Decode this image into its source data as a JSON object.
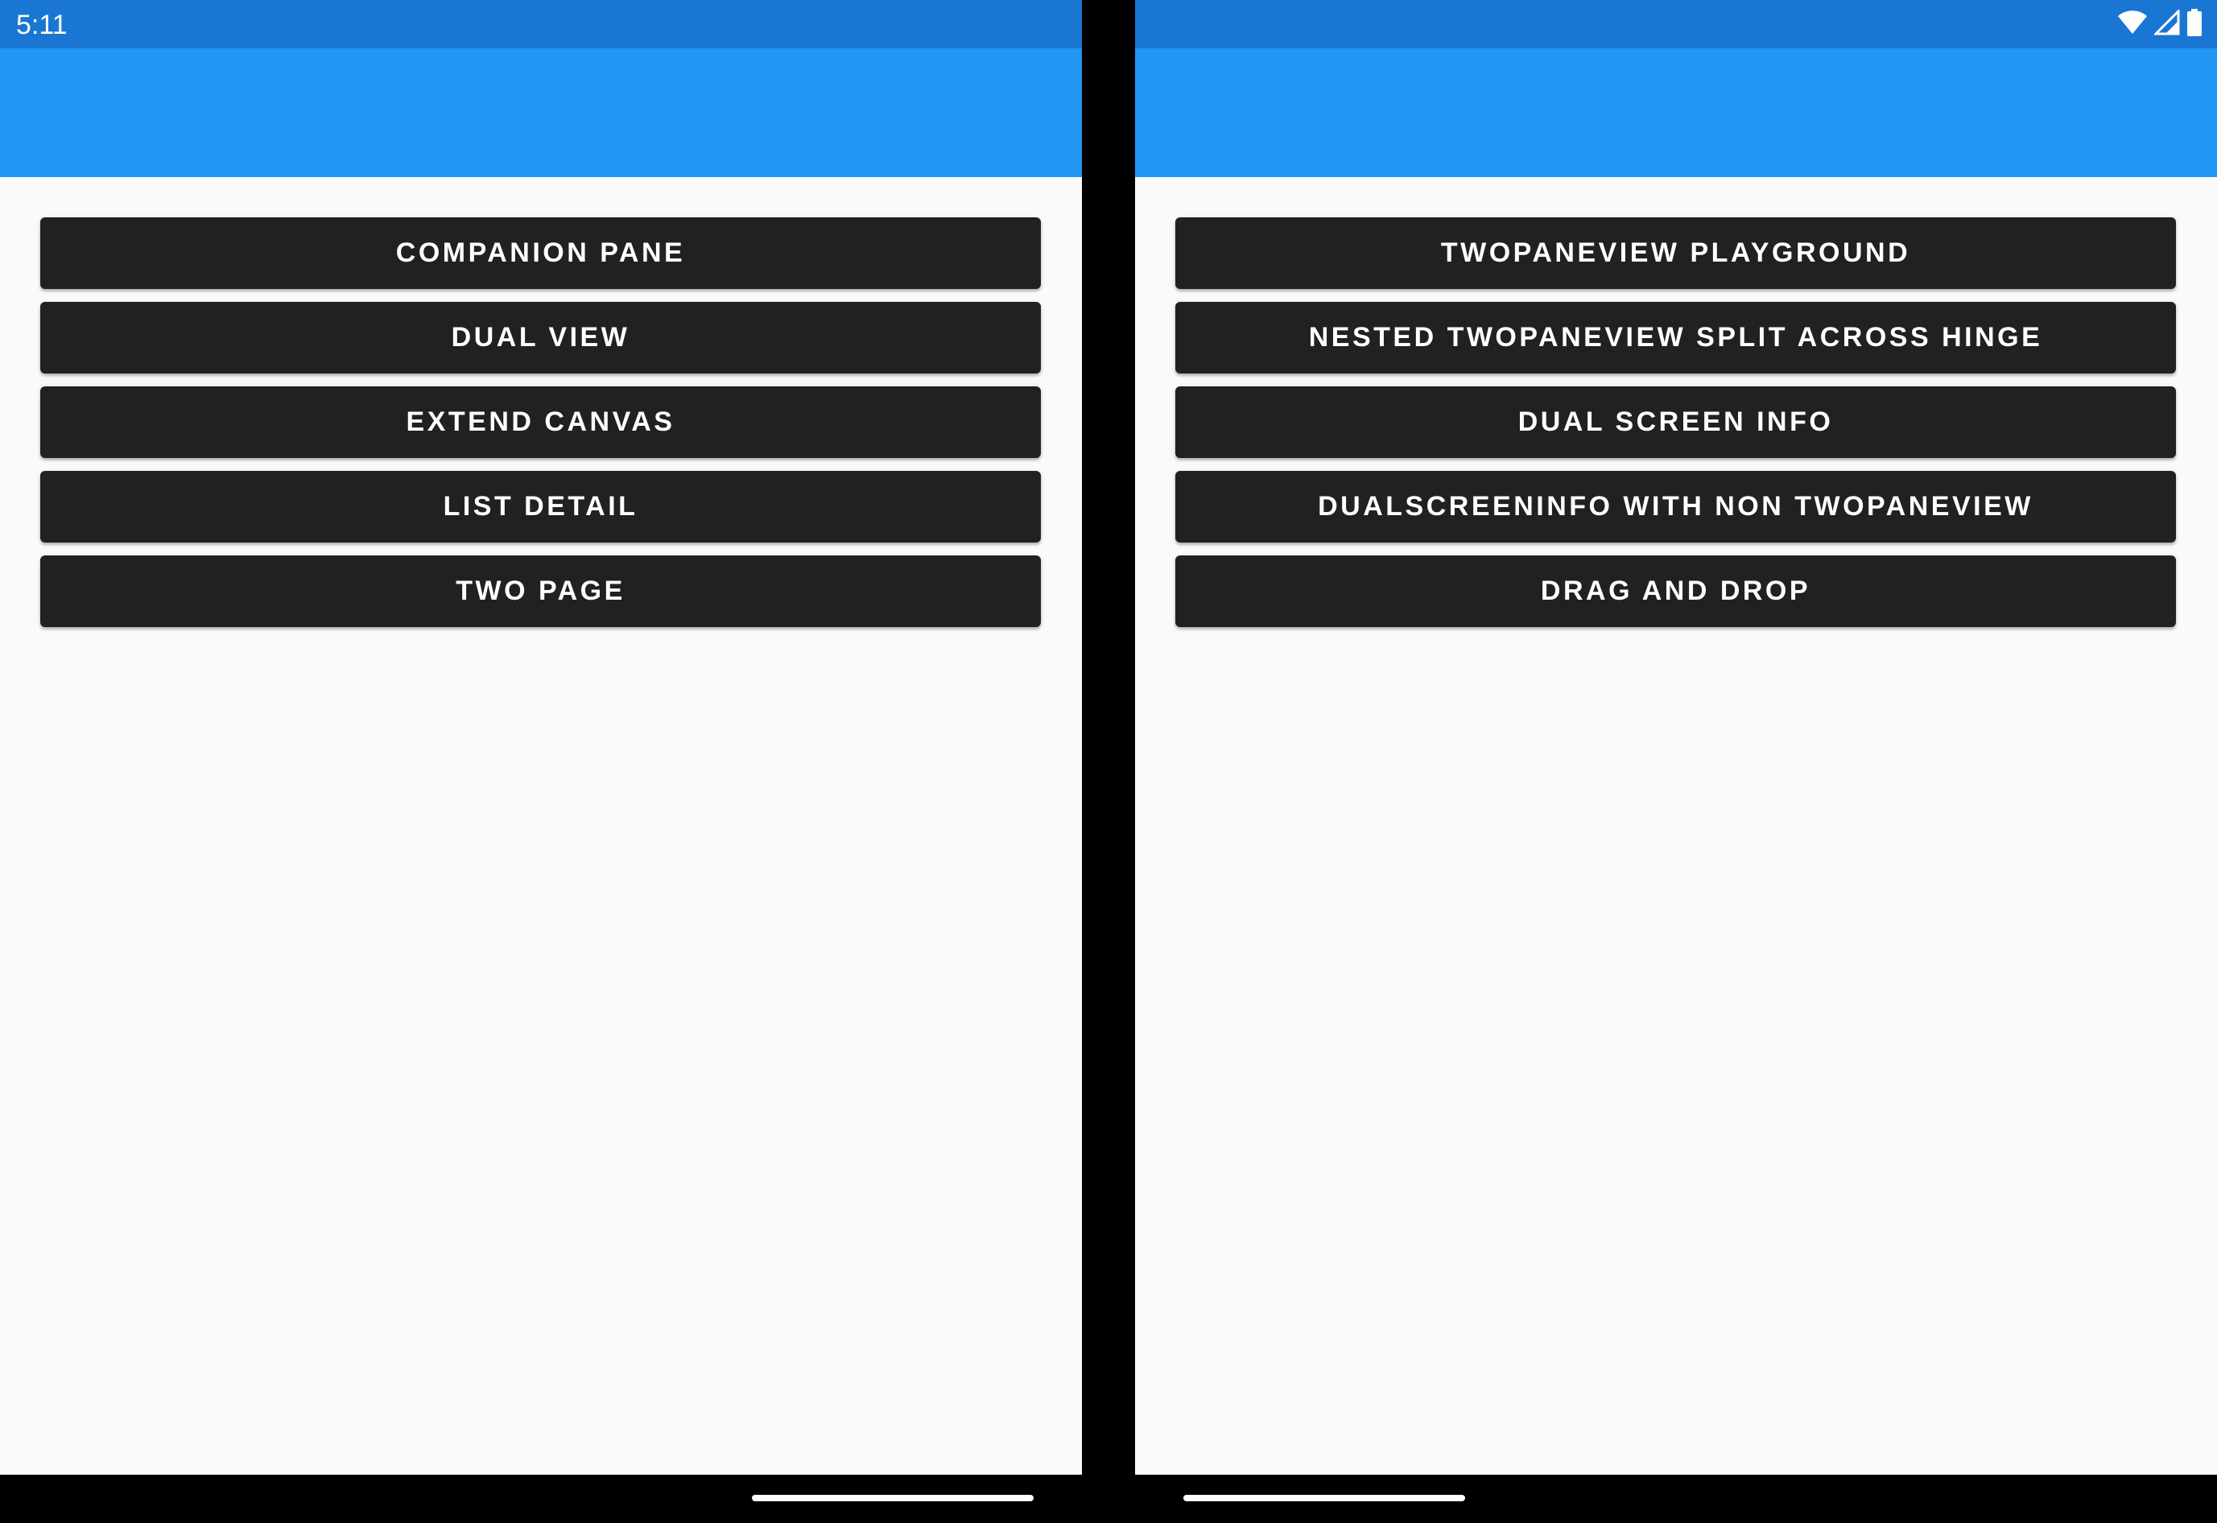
{
  "status_bar": {
    "time": "5:11",
    "icons": [
      "wifi-icon",
      "cell-signal-icon",
      "battery-icon"
    ]
  },
  "left_pane": {
    "buttons": [
      {
        "label": "COMPANION PANE"
      },
      {
        "label": "DUAL VIEW"
      },
      {
        "label": "EXTEND CANVAS"
      },
      {
        "label": "LIST DETAIL"
      },
      {
        "label": "TWO PAGE"
      }
    ]
  },
  "right_pane": {
    "buttons": [
      {
        "label": "TWOPANEVIEW PLAYGROUND"
      },
      {
        "label": "NESTED TWOPANEVIEW SPLIT ACROSS HINGE"
      },
      {
        "label": "DUAL SCREEN INFO"
      },
      {
        "label": "DUALSCREENINFO WITH NON TWOPANEVIEW"
      },
      {
        "label": "DRAG AND DROP"
      }
    ]
  },
  "colors": {
    "status_bar": "#1976d2",
    "app_bar": "#2196f3",
    "button_bg": "#212121",
    "button_text": "#ffffff",
    "content_bg": "#fafafa",
    "hinge": "#000000"
  }
}
